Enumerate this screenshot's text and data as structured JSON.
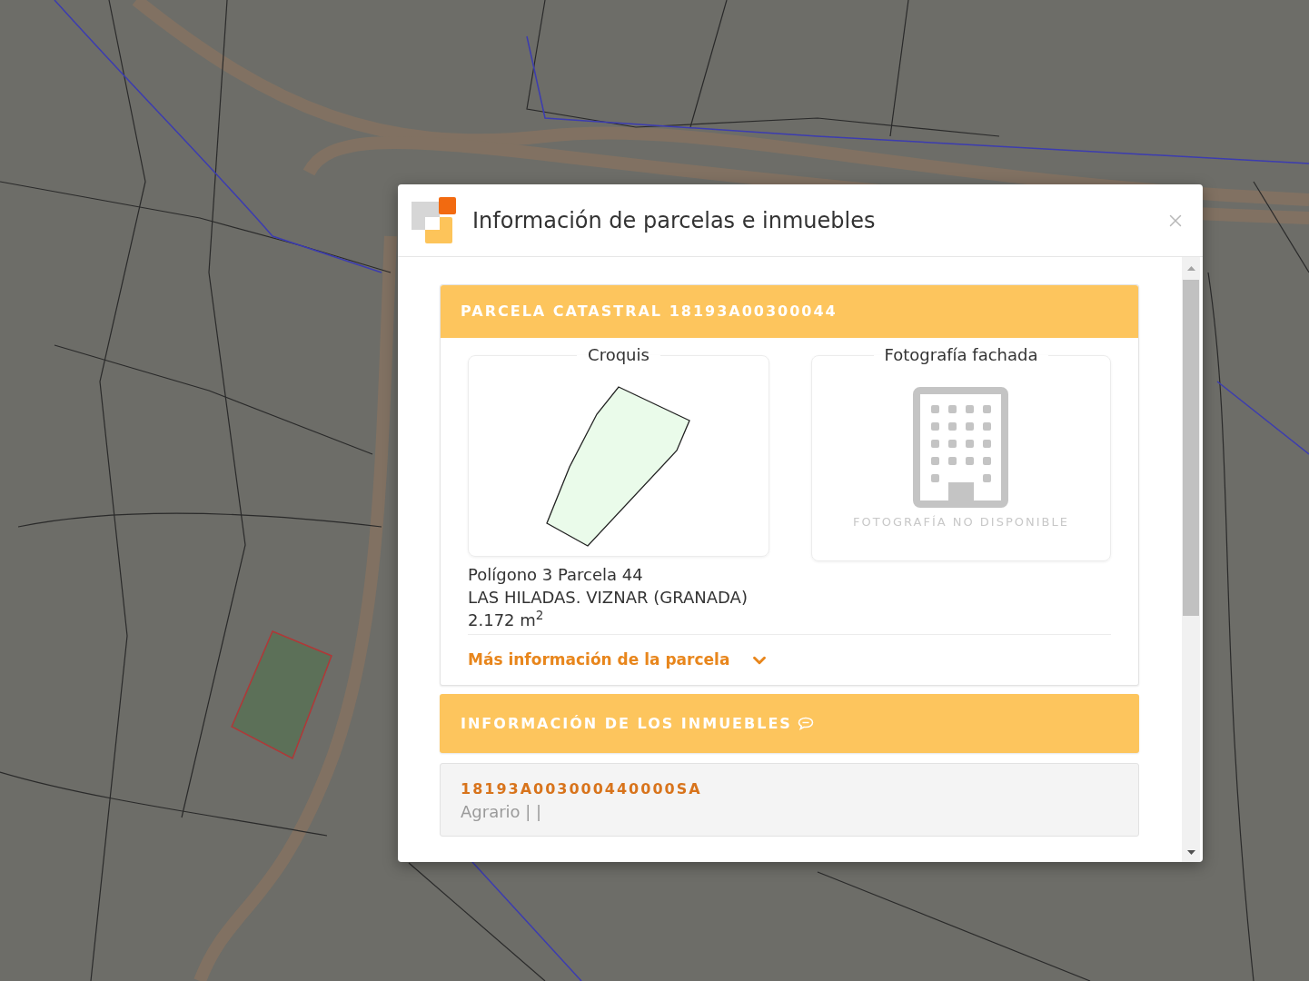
{
  "dialog": {
    "title": "Información de parcelas e inmuebles"
  },
  "parcel": {
    "heading": "PARCELA CATASTRAL 18193A00300044",
    "sketch": {
      "legend": "Croquis"
    },
    "photo": {
      "legend": "Fotografía fachada",
      "message": "FOTOGRAFÍA NO DISPONIBLE"
    },
    "details": [
      "Polígono 3 Parcela 44",
      "LAS HILADAS. VIZNAR (GRANADA)",
      "2.172 m$^{2}$"
    ],
    "more_link": {
      "label": "Más información de la parcela",
      "expanded": false
    }
  },
  "properties": {
    "heading": "INFORMACIÓN DE LOS INMUEBLES",
    "items": [
      {
        "reference": "18193A003000440000SA",
        "description": "Agrario | |"
      }
    ]
  }
}
